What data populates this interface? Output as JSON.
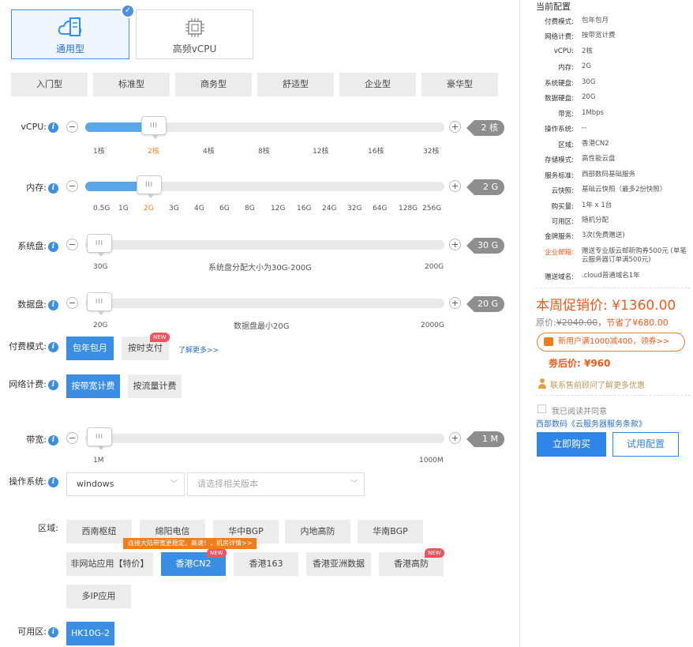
{
  "types": [
    {
      "label": "通用型",
      "selected": true,
      "icon": "cloud-server-icon"
    },
    {
      "label": "高频vCPU",
      "selected": false,
      "icon": "cpu-chip-icon"
    }
  ],
  "tiers": [
    "入门型",
    "标准型",
    "商务型",
    "舒适型",
    "企业型",
    "豪华型"
  ],
  "vcpu": {
    "label": "vCPU:",
    "value": "2 核",
    "ticks": [
      "1核",
      "2核",
      "4核",
      "8核",
      "12核",
      "16核",
      "32核"
    ],
    "selected_index": 1
  },
  "memory": {
    "label": "内存:",
    "value": "2 G",
    "ticks": [
      "0.5G",
      "1G",
      "2G",
      "3G",
      "4G",
      "6G",
      "8G",
      "12G",
      "16G",
      "24G",
      "32G",
      "64G",
      "128G",
      "256G"
    ],
    "selected_index": 2
  },
  "system_disk": {
    "label": "系统盘:",
    "value": "30 G",
    "min": "30G",
    "max": "200G",
    "note": "系统盘分配大小为30G-200G"
  },
  "data_disk": {
    "label": "数据盘:",
    "value": "20 G",
    "min": "20G",
    "max": "2000G",
    "note": "数据盘最小20G"
  },
  "billing": {
    "label": "付费模式:",
    "options": [
      "包年包月",
      "按时支付"
    ],
    "selected": 0,
    "new_tag": "NEW",
    "more_link": "了解更多>>"
  },
  "network": {
    "label": "网络计费:",
    "options": [
      "按带宽计费",
      "按流量计费"
    ],
    "selected": 0
  },
  "bandwidth": {
    "label": "带宽:",
    "value": "1 M",
    "min": "1M",
    "max": "1000M"
  },
  "os": {
    "label": "操作系统:",
    "selected": "windows",
    "version_placeholder": "请选择相关版本"
  },
  "region": {
    "label": "区域:",
    "row1": [
      "西南枢纽",
      "绵阳电信",
      "华中BGP",
      "内地高防",
      "华南BGP"
    ],
    "row2": [
      "非网站应用【特价】",
      "香港CN2",
      "香港163",
      "香港亚洲数据",
      "香港高防"
    ],
    "row3": [
      "多IP应用"
    ],
    "selected": "香港CN2",
    "tip": "连接大陆带宽更稳定、高速！，机房详情>>",
    "new_tag": "NEW"
  },
  "zone": {
    "label": "可用区:",
    "value": "HK10G-2"
  },
  "summary": {
    "title": "当前配置",
    "specs": [
      {
        "k": "付费模式:",
        "v": "包年包月"
      },
      {
        "k": "网络计费:",
        "v": "按带宽计费"
      },
      {
        "k": "vCPU:",
        "v": "2核"
      },
      {
        "k": "内存:",
        "v": "2G"
      },
      {
        "k": "系统硬盘:",
        "v": "30G"
      },
      {
        "k": "数据硬盘:",
        "v": "20G"
      },
      {
        "k": "带宽:",
        "v": "1Mbps"
      },
      {
        "k": "操作系统:",
        "v": "--"
      },
      {
        "k": "区域:",
        "v": "香港CN2"
      },
      {
        "k": "存储模式:",
        "v": "高性能云盘"
      },
      {
        "k": "服务标准:",
        "v": "西部数码基础服务"
      },
      {
        "k": "云快照:",
        "v": "基础云快照（最多2份快照）"
      },
      {
        "k": "购买量:",
        "v": "1年 x 1台"
      },
      {
        "k": "可用区:",
        "v": "随机分配"
      },
      {
        "k": "金牌服务:",
        "v": "3次(免费赠送)"
      },
      {
        "k": "企业邮箱:",
        "v": "赠送专业版云邮新购券500元 (单笔云服务器订单满500元)"
      },
      {
        "k": "赠送域名:",
        "v": ".cloud普通域名1年"
      }
    ],
    "promo_price": "本周促销价: ¥1360.00",
    "original_label": "原价:",
    "original_value": "¥2040.00",
    "save_text": "，节省了¥680.00",
    "coupon": "新用户满1000减400，领券>>",
    "after_coupon": "劵后价: ¥960",
    "consult": "联系售前顾问了解更多优惠",
    "agree": "我已阅读并同意",
    "terms": "西部数码《云服务器服务条款》",
    "buy": "立即购买",
    "trial": "试用配置"
  },
  "colors": {
    "accent": "#3a8ee6",
    "orange": "#f05a1a",
    "tag_gray": "#8e8e8e",
    "new_red": "#f0545c"
  }
}
